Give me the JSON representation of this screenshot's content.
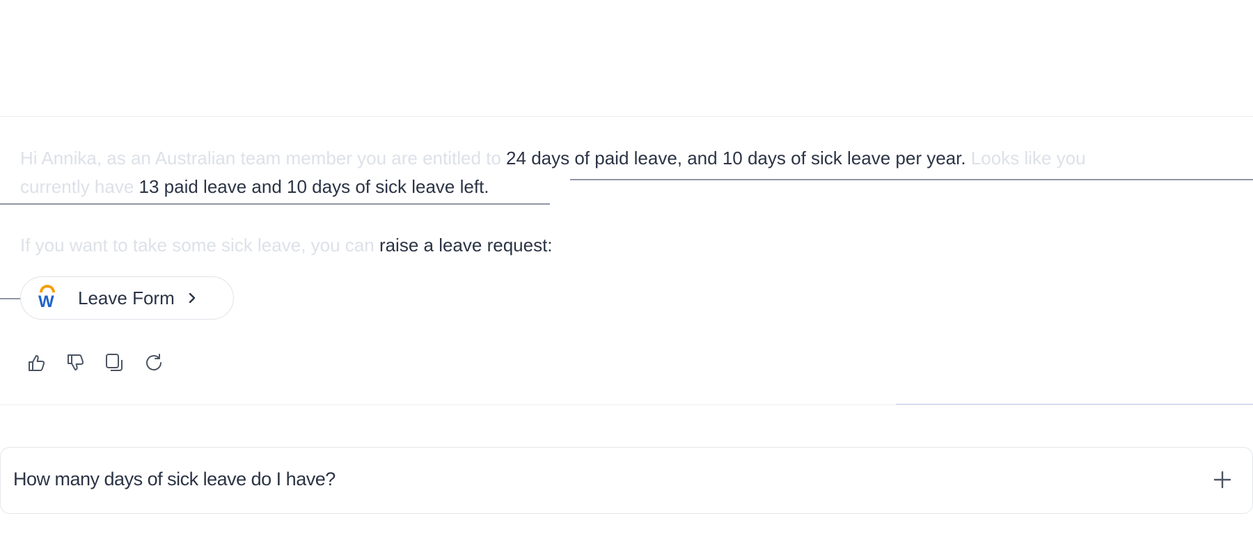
{
  "message": {
    "line1_faded": "Hi Annika, as an Australian team member you are entitled to ",
    "line1_highlight": "24 days of paid leave, and 10 days of sick leave per year.",
    "line1_faded_end": " Looks like you",
    "line2_faded": "currently have ",
    "line2_highlight": "13 paid leave and 10 days of sick leave left.",
    "para2_faded": "If you want to take some sick leave, you can ",
    "para2_highlight": "raise a leave request:"
  },
  "leave_form_button": {
    "logo_letter": "W",
    "label": "Leave Form"
  },
  "actions": {
    "icons": [
      "thumbs-up-icon",
      "thumbs-down-icon",
      "copy-icon",
      "regenerate-icon"
    ]
  },
  "input": {
    "value": "How many days of sick leave do I have?"
  },
  "colors": {
    "faded_text": "#dde1e8",
    "highlight_text": "#2b3445",
    "accent_line": "#c6c9f5",
    "logo_orange": "#f59e0b",
    "logo_blue": "#1d63c9"
  }
}
